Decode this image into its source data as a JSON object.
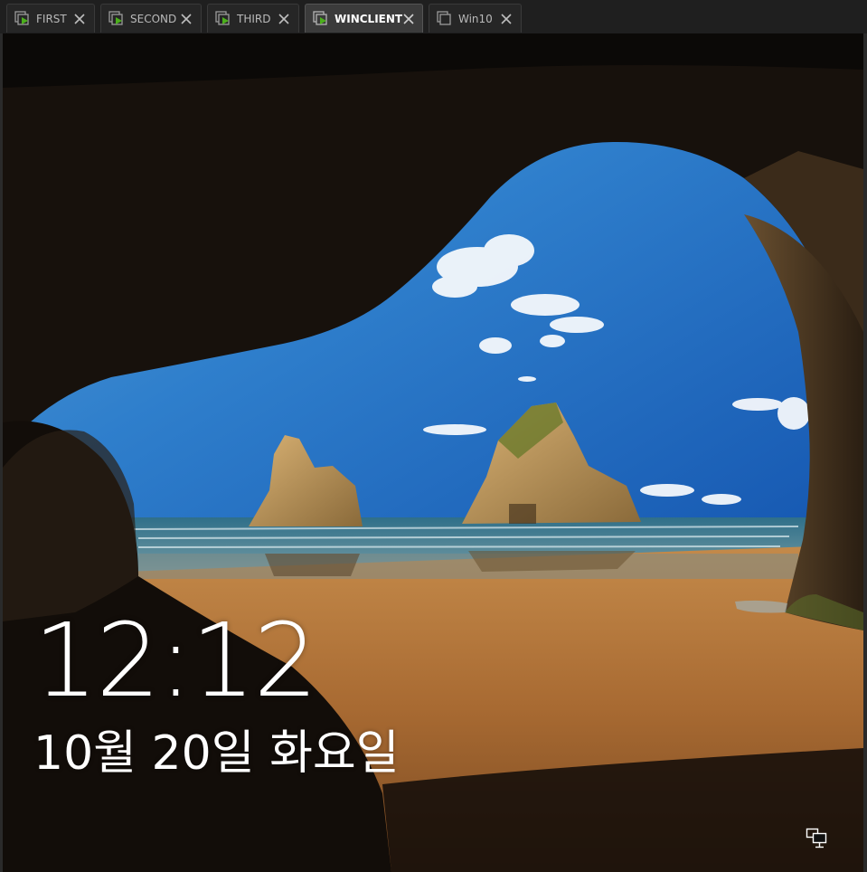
{
  "tabs": [
    {
      "label": "FIRST",
      "active": false
    },
    {
      "label": "SECOND",
      "active": false
    },
    {
      "label": "THIRD",
      "active": false
    },
    {
      "label": "WINCLIENT",
      "active": true
    },
    {
      "label": "Win10",
      "active": false
    }
  ],
  "lockscreen": {
    "time": "12:12",
    "date": "10월 20일 화요일",
    "network_icon": "network-monitor-icon"
  },
  "colors": {
    "vm_icon_accent": "#4caf1c",
    "tab_active_bg": "#3b3b3b",
    "tab_bg": "#262626"
  }
}
